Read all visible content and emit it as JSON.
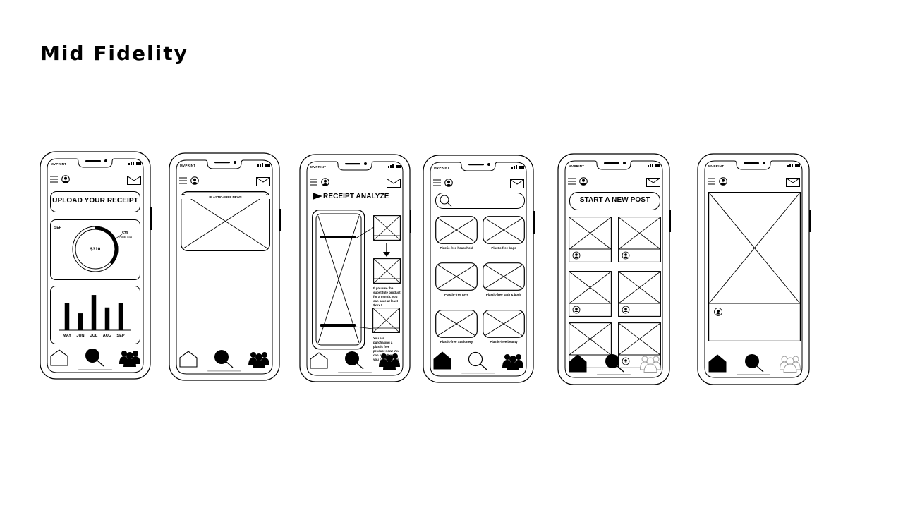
{
  "page": {
    "title": "Mid Fidelity"
  },
  "common": {
    "brand": "MVPRINT"
  },
  "screen1": {
    "button_label": "UPLOAD YOUR RECEIPT",
    "month": "SEP",
    "amount": "$310",
    "goal_amount": "$70",
    "goal_caption": "Plastic Goal",
    "chart_data": {
      "type": "bar",
      "categories": [
        "MAY",
        "JUN",
        "JUL",
        "AUG",
        "SEP"
      ],
      "values": [
        37,
        23,
        48,
        31,
        37
      ]
    }
  },
  "screen2": {
    "news_title": "PLASTIC-FREE NEWS"
  },
  "screen3": {
    "title": "RECEIPT ANALYZE",
    "tip_text": "If you use the substitute product for a month, you can save at least $xxx !",
    "purchase_text": "You are purchasing a plastic free product now! You can save $xxx if you continue this unit for..."
  },
  "screen4": {
    "categories": [
      "Plastic-free household",
      "Plastic-free bags",
      "Plastic-free toys",
      "Plastic-free bath & body",
      "Plastic-free Stationery",
      "Plastic-free beauty"
    ]
  },
  "screen5": {
    "button_label": "START A NEW POST"
  },
  "icons": {
    "menu": "menu-icon",
    "profile": "profile-icon",
    "mail": "mail-icon",
    "home": "home-icon",
    "search": "search-icon",
    "community": "community-icon",
    "play": "play-icon",
    "image_placeholder": "image-placeholder-icon"
  }
}
